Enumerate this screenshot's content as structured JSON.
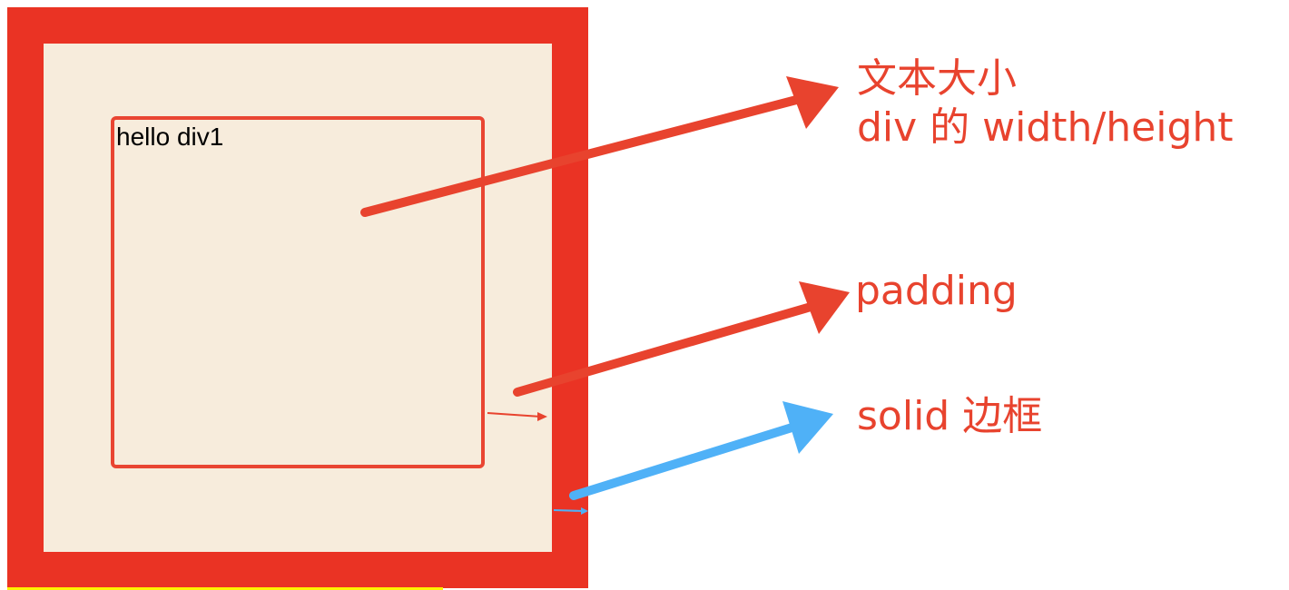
{
  "box": {
    "content_text": "hello div1"
  },
  "labels": {
    "content_size_line1": "文本大小",
    "content_size_line2": "div 的 width/height",
    "padding": "padding",
    "border": "solid 边框"
  },
  "colors": {
    "border": "#ea3324",
    "padding_bg": "#f7ecdc",
    "content_outline": "#e94532",
    "annotation_red": "#e8432e",
    "annotation_blue": "#4fb1f7"
  }
}
